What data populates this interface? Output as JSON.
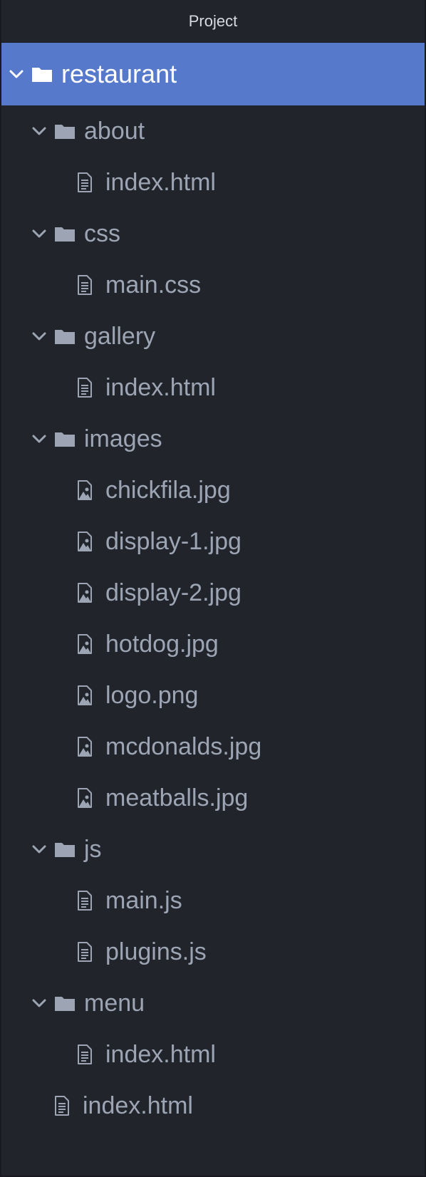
{
  "panel": {
    "title": "Project"
  },
  "colors": {
    "background": "#21252b",
    "selected": "#5679cc",
    "text": "#9da5b4",
    "icon": "#9da5b4"
  },
  "tree": [
    {
      "label": "restaurant",
      "kind": "folder",
      "level": 0,
      "expanded": true,
      "selected": true,
      "name": "tree-item-restaurant"
    },
    {
      "label": "about",
      "kind": "folder",
      "level": 1,
      "expanded": true,
      "name": "tree-item-about"
    },
    {
      "label": "index.html",
      "kind": "file",
      "level": 2,
      "name": "tree-item-about-index-html"
    },
    {
      "label": "css",
      "kind": "folder",
      "level": 1,
      "expanded": true,
      "name": "tree-item-css"
    },
    {
      "label": "main.css",
      "kind": "file",
      "level": 2,
      "name": "tree-item-main-css"
    },
    {
      "label": "gallery",
      "kind": "folder",
      "level": 1,
      "expanded": true,
      "name": "tree-item-gallery"
    },
    {
      "label": "index.html",
      "kind": "file",
      "level": 2,
      "name": "tree-item-gallery-index-html"
    },
    {
      "label": "images",
      "kind": "folder",
      "level": 1,
      "expanded": true,
      "name": "tree-item-images"
    },
    {
      "label": "chickfila.jpg",
      "kind": "image",
      "level": 2,
      "name": "tree-item-chickfila-jpg"
    },
    {
      "label": "display-1.jpg",
      "kind": "image",
      "level": 2,
      "name": "tree-item-display-1-jpg"
    },
    {
      "label": "display-2.jpg",
      "kind": "image",
      "level": 2,
      "name": "tree-item-display-2-jpg"
    },
    {
      "label": "hotdog.jpg",
      "kind": "image",
      "level": 2,
      "name": "tree-item-hotdog-jpg"
    },
    {
      "label": "logo.png",
      "kind": "image",
      "level": 2,
      "name": "tree-item-logo-png"
    },
    {
      "label": "mcdonalds.jpg",
      "kind": "image",
      "level": 2,
      "name": "tree-item-mcdonalds-jpg"
    },
    {
      "label": "meatballs.jpg",
      "kind": "image",
      "level": 2,
      "name": "tree-item-meatballs-jpg"
    },
    {
      "label": "js",
      "kind": "folder",
      "level": 1,
      "expanded": true,
      "name": "tree-item-js"
    },
    {
      "label": "main.js",
      "kind": "file",
      "level": 2,
      "name": "tree-item-main-js"
    },
    {
      "label": "plugins.js",
      "kind": "file",
      "level": 2,
      "name": "tree-item-plugins-js"
    },
    {
      "label": "menu",
      "kind": "folder",
      "level": 1,
      "expanded": true,
      "name": "tree-item-menu"
    },
    {
      "label": "index.html",
      "kind": "file",
      "level": 2,
      "name": "tree-item-menu-index-html"
    },
    {
      "label": "index.html",
      "kind": "file",
      "level": 1,
      "name": "tree-item-root-index-html"
    }
  ]
}
